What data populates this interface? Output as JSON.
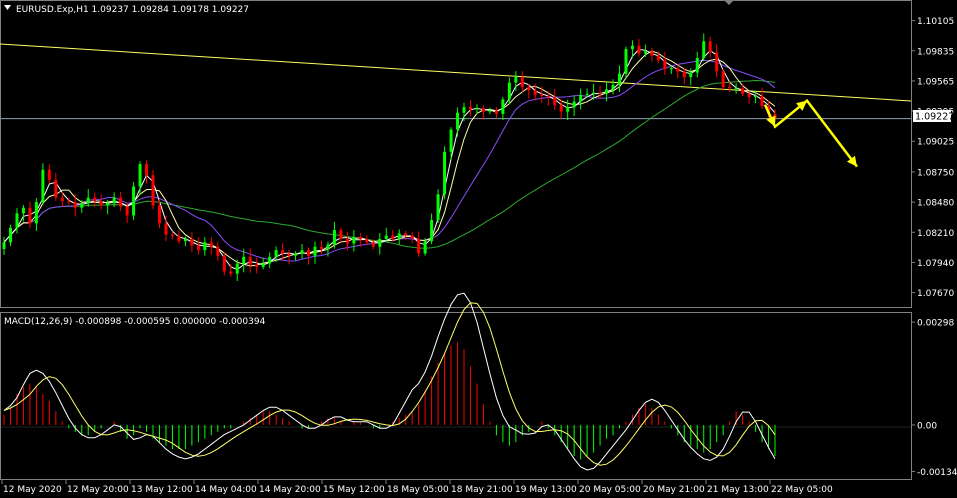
{
  "chart_data": [
    {
      "type": "candlestick",
      "title": "EURUSD.Exp,H1  1.09237 1.09284 1.09178 1.09227",
      "ylim": [
        1.0755,
        1.102
      ],
      "y_ticks": [
        "1.10105",
        "1.09835",
        "1.09565",
        "1.09295",
        "1.09025",
        "1.08750",
        "1.08480",
        "1.08210",
        "1.07940",
        "1.07670"
      ],
      "current_price": "1.09227",
      "colors": {
        "bull": "#00ff00",
        "bear": "#ff0000",
        "trendline": "#ffff66",
        "ma_fast": "#ffffff",
        "ma_mid": "#ffffaa",
        "ma_slow_purple": "#8a4dff",
        "ma_long_green": "#2fa82f",
        "arrow": "#ffff00",
        "hline": "#8fa3b3"
      },
      "closes": [
        1.0812,
        1.0825,
        1.0838,
        1.0843,
        1.0829,
        1.0848,
        1.0877,
        1.0868,
        1.0852,
        1.0849,
        1.0848,
        1.0843,
        1.0847,
        1.0852,
        1.0849,
        1.0845,
        1.0847,
        1.0852,
        1.0844,
        1.0836,
        1.0862,
        1.0882,
        1.0872,
        1.0845,
        1.0829,
        1.0819,
        1.0818,
        1.0813,
        1.0815,
        1.0809,
        1.0805,
        1.0812,
        1.0808,
        1.08,
        1.0786,
        1.0784,
        1.0793,
        1.0799,
        1.0792,
        1.079,
        1.0793,
        1.0799,
        1.0805,
        1.0802,
        1.08,
        1.0802,
        1.0805,
        1.08,
        1.0808,
        1.0806,
        1.081,
        1.0823,
        1.0815,
        1.0811,
        1.0817,
        1.0815,
        1.0812,
        1.0808,
        1.0815,
        1.0818,
        1.0815,
        1.082,
        1.0818,
        1.0815,
        1.0802,
        1.0813,
        1.0832,
        1.0855,
        1.0893,
        1.0913,
        1.0928,
        1.0933,
        1.0931,
        1.0932,
        1.0929,
        1.093,
        1.0927,
        1.094,
        1.0955,
        1.096,
        1.0951,
        1.0948,
        1.0944,
        1.0943,
        1.0942,
        1.0935,
        1.0929,
        1.0933,
        1.0938,
        1.0944,
        1.0945,
        1.0946,
        1.0945,
        1.0949,
        1.0953,
        1.0963,
        1.0985,
        1.0988,
        1.0981,
        1.0983,
        1.0979,
        1.0975,
        1.0967,
        1.0968,
        1.0965,
        1.096,
        1.0964,
        1.0977,
        1.0992,
        1.0982,
        1.0965,
        1.0951,
        1.095,
        1.095,
        1.0945,
        1.0942,
        1.0943,
        1.0934,
        1.0927,
        1.09227
      ],
      "macd_histogram": [
        0.0003,
        0.0005,
        0.0009,
        0.0011,
        0.0012,
        0.0011,
        0.0009,
        0.0007,
        0.0004,
        0.0001,
        -0.0001,
        -0.0002,
        -0.0003,
        -0.0003,
        -0.0002,
        -0.0001,
        0.0,
        0.0001,
        -0.0002,
        -0.0004,
        -0.0003,
        -0.0001,
        -0.0002,
        -0.0004,
        -0.0005,
        -0.0006,
        -0.0007,
        -0.0007,
        -0.0007,
        -0.0006,
        -0.0005,
        -0.0004,
        -0.0003,
        -0.0002,
        -0.0001,
        -0.0001,
        0.0,
        0.0001,
        0.0002,
        0.0003,
        0.0004,
        0.0004,
        0.0003,
        0.0002,
        0.0001,
        0.0,
        -0.0001,
        -0.0001,
        0.0,
        0.0001,
        0.0002,
        0.0002,
        0.0001,
        0.0,
        0.0001,
        0.0001,
        0.0,
        -0.0001,
        -0.0001,
        0.0,
        0.0001,
        0.0002,
        0.0003,
        0.0004,
        0.0006,
        0.001,
        0.0014,
        0.0018,
        0.0021,
        0.0023,
        0.0024,
        0.0022,
        0.0017,
        0.0012,
        0.0006,
        0.0001,
        -0.0003,
        -0.0005,
        -0.0006,
        -0.0005,
        -0.0003,
        -0.0002,
        0.0,
        0.0001,
        -0.0001,
        -0.0003,
        -0.0005,
        -0.0007,
        -0.0009,
        -0.001,
        -0.0009,
        -0.0008,
        -0.0006,
        -0.0004,
        -0.0003,
        -0.0001,
        0.0001,
        0.0003,
        0.0005,
        0.0006,
        0.0005,
        0.0003,
        0.0001,
        -0.0001,
        -0.0003,
        -0.0005,
        -0.0006,
        -0.0007,
        -0.0008,
        -0.0007,
        -0.0005,
        -0.0003,
        0.0001,
        0.0004,
        0.0003,
        0.0001,
        -0.0002,
        -0.0005,
        -0.0007,
        -0.0009
      ],
      "macd_label": "MACD(12,26,9) -0.000898 -0.000595 0.000000 -0.000394",
      "macd_ylim": [
        -0.00148,
        0.0031
      ],
      "macd_ticks": [
        "0.00298",
        "0.00",
        "-0.001348"
      ],
      "x_labels": [
        "12 May 2020",
        "12 May 20:00",
        "13 May 12:00",
        "14 May 04:00",
        "14 May 20:00",
        "15 May 12:00",
        "18 May 05:00",
        "18 May 21:00",
        "19 May 13:00",
        "20 May 05:00",
        "20 May 21:00",
        "21 May 13:00",
        "22 May 05:00"
      ]
    }
  ]
}
